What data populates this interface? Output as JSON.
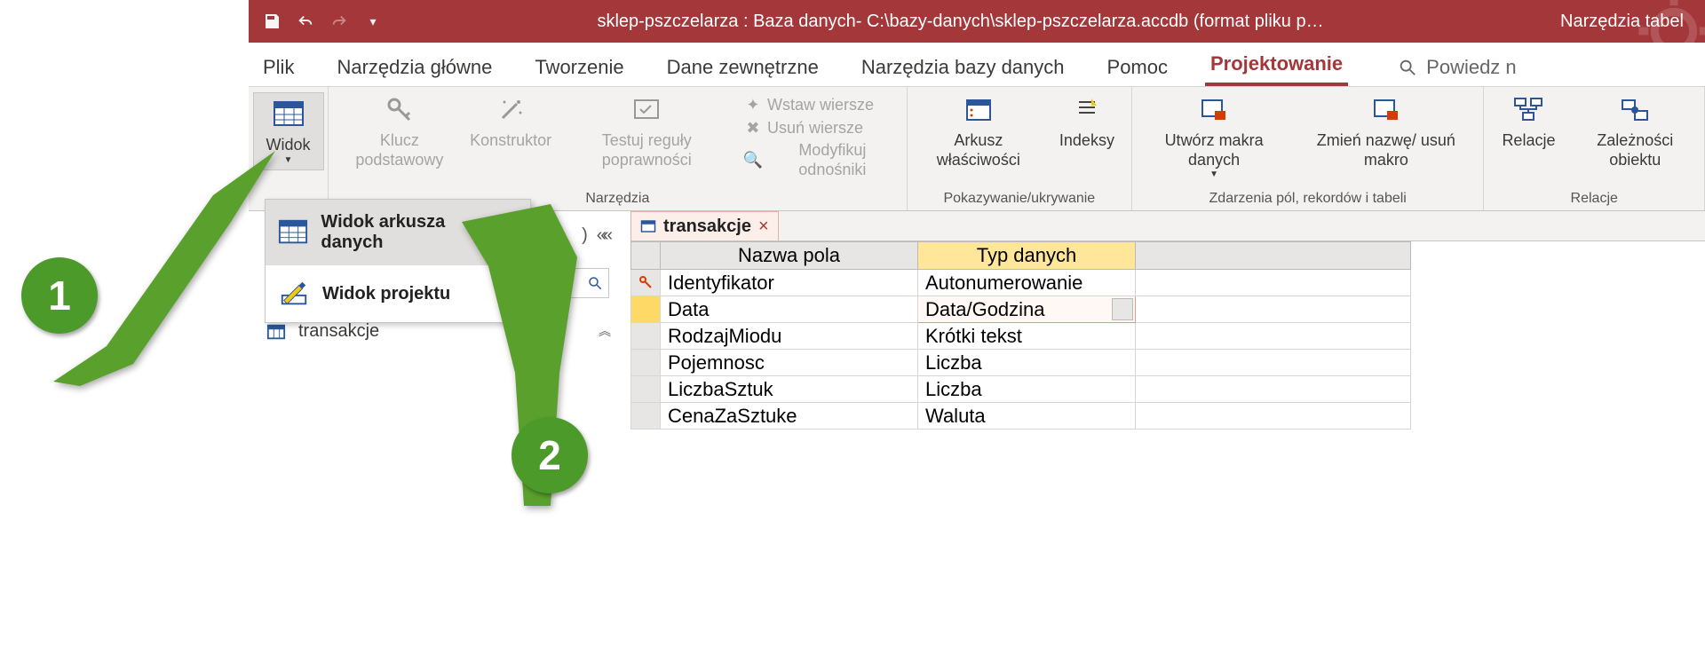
{
  "titlebar": {
    "title": "sklep-pszczelarza : Baza danych- C:\\bazy-danych\\sklep-pszczelarza.accdb (format pliku p…",
    "context_tab": "Narzędzia tabel"
  },
  "tabs": {
    "file": "Plik",
    "home": "Narzędzia główne",
    "create": "Tworzenie",
    "external": "Dane zewnętrzne",
    "dbtools": "Narzędzia bazy danych",
    "help": "Pomoc",
    "design": "Projektowanie",
    "tellme": "Powiedz n"
  },
  "ribbon": {
    "views": {
      "label": "Widok"
    },
    "tools": {
      "pk": "Klucz podstawowy",
      "builder": "Konstruktor",
      "validate": "Testuj reguły poprawności",
      "insert_rows": "Wstaw wiersze",
      "delete_rows": "Usuń wiersze",
      "modify_lookups": "Modyfikuj odnośniki",
      "group_label": "Narzędzia"
    },
    "showhide": {
      "propsheet": "Arkusz właściwości",
      "indexes": "Indeksy",
      "group_label": "Pokazywanie/ukrywanie"
    },
    "events": {
      "create_macros": "Utwórz makra danych",
      "rename_delete": "Zmień nazwę/ usuń makro",
      "group_label": "Zdarzenia pól, rekordów i tabeli"
    },
    "relations": {
      "relationships": "Relacje",
      "dependencies": "Zależności obiektu",
      "group_label": "Relacje"
    }
  },
  "view_menu": {
    "datasheet": "Widok arkusza danych",
    "design": "Widok projektu"
  },
  "nav": {
    "table": "transakcje"
  },
  "doc": {
    "tab": "transakcje",
    "headers": {
      "name": "Nazwa pola",
      "type": "Typ danych"
    },
    "rows": [
      {
        "name": "Identyfikator",
        "type": "Autonumerowanie",
        "pk": true
      },
      {
        "name": "Data",
        "type": "Data/Godzina",
        "active": true
      },
      {
        "name": "RodzajMiodu",
        "type": "Krótki tekst"
      },
      {
        "name": "Pojemnosc",
        "type": "Liczba"
      },
      {
        "name": "LiczbaSztuk",
        "type": "Liczba"
      },
      {
        "name": "CenaZaSztuke",
        "type": "Waluta"
      }
    ]
  },
  "steps": {
    "one": "1",
    "two": "2"
  }
}
